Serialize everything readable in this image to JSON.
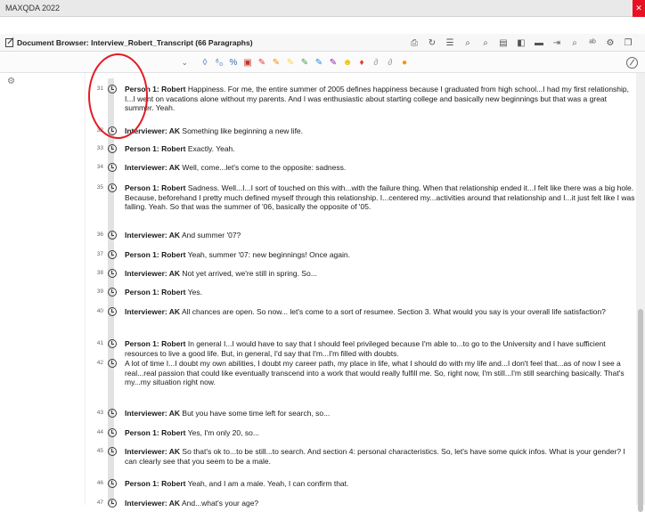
{
  "app": {
    "title": "MAXQDA 2022",
    "close": "✕"
  },
  "document": {
    "title": "Document Browser: Interview_Robert_Transcript  (66 Paragraphs)"
  },
  "header_icons": [
    "export-icon",
    "refresh-icon",
    "list-icon",
    "search-icon",
    "search-plus-icon",
    "view-icon",
    "panel-icon",
    "monitor-icon",
    "exit-icon",
    "find-icon",
    "spell-icon",
    "gear-icon",
    "window-icon"
  ],
  "toolbar": {
    "style_value": "",
    "icons": [
      {
        "name": "paragraph-icon",
        "glyph": "◊",
        "color": "#3a6fb5"
      },
      {
        "name": "format-icon",
        "glyph": "⁶₀",
        "color": "#3a6fb5"
      },
      {
        "name": "percent-icon",
        "glyph": "%",
        "color": "#3a6fb5"
      },
      {
        "name": "code-icon",
        "glyph": "▣",
        "color": "#c0392b"
      },
      {
        "name": "highlighter-red-icon",
        "glyph": "✎",
        "color": "#e53935"
      },
      {
        "name": "highlighter-orange-icon",
        "glyph": "✎",
        "color": "#fb8c00"
      },
      {
        "name": "highlighter-yellow-icon",
        "glyph": "✎",
        "color": "#fdd835"
      },
      {
        "name": "highlighter-green-icon",
        "glyph": "✎",
        "color": "#43a047"
      },
      {
        "name": "highlighter-blue-icon",
        "glyph": "✎",
        "color": "#1e88e5"
      },
      {
        "name": "highlighter-purple-icon",
        "glyph": "✎",
        "color": "#8e24aa"
      },
      {
        "name": "emoji-icon",
        "glyph": "☻",
        "color": "#f1c40f"
      },
      {
        "name": "pin-icon",
        "glyph": "♦",
        "color": "#e53935"
      },
      {
        "name": "link-icon",
        "glyph": "∂",
        "color": "#9e9e9e"
      },
      {
        "name": "link2-icon",
        "glyph": "∂",
        "color": "#9e9e9e"
      },
      {
        "name": "comment-icon",
        "glyph": "●",
        "color": "#ff8f00"
      }
    ]
  },
  "paragraphs": [
    {
      "num": "31",
      "speaker": "Person 1: Robert",
      "text": " Happiness. For me, the entire summer of 2005 defines happiness because I graduated from high school...I had my first relationship, I...I went on vacations alone without my parents. And I was enthusiastic about starting college and basically new beginnings but that was a great summer. Yeah."
    },
    {
      "num": "32",
      "speaker": "Interviewer: AK",
      "text": " Something like beginning a new life."
    },
    {
      "num": "33",
      "speaker": "Person 1: Robert",
      "text": " Exactly. Yeah."
    },
    {
      "num": "34",
      "speaker": "Interviewer: AK",
      "text": " Well, come...let's come to the opposite: sadness."
    },
    {
      "num": "35",
      "speaker": "Person 1: Robert",
      "text": " Sadness. Well...I...I sort of touched on this with...with the failure thing. When that relationship ended it...I felt like there was a big hole. Because, beforehand I pretty much defined myself through this relationship. I...centered my...activities around that relationship and I...it just felt like I was falling. Yeah. So that was the summer of '06, basically the opposite of '05."
    },
    {
      "num": "36",
      "speaker": "Interviewer: AK",
      "text": " And summer '07?"
    },
    {
      "num": "37",
      "speaker": "Person 1: Robert",
      "text": " Yeah, summer '07: new beginnings! Once again."
    },
    {
      "num": "38",
      "speaker": "Interviewer: AK",
      "text": " Not yet arrived, we're still in spring. So..."
    },
    {
      "num": "39",
      "speaker": "Person 1: Robert",
      "text": " Yes."
    },
    {
      "num": "40",
      "speaker": "Interviewer: AK",
      "text": " All chances are open. So now... let's come to a sort of resumee. Section 3. What would you say is your overall life satisfaction?"
    },
    {
      "num": "41",
      "speaker": "Person 1: Robert",
      "text": " In general I...I would have to say that I should feel privileged because I'm able to...to go to the University and I have sufficient resources to live a good life. But, in general, I'd say that I'm...I'm filled with doubts."
    },
    {
      "num": "42",
      "speaker": "",
      "text": "A lot of time I...I doubt my own abilities, I doubt my career path, my place in life, what I should do with my life and...I don't feel that...as of now I see a real...real passion that could like eventually transcend into a work that would really fulfill me. So, right now, I'm still...I'm still searching basically. That's my...my situation right now."
    },
    {
      "num": "43",
      "speaker": "Interviewer: AK",
      "text": " But you have some time left for search, so..."
    },
    {
      "num": "44",
      "speaker": "Person 1: Robert",
      "text": " Yes, I'm only 20, so..."
    },
    {
      "num": "45",
      "speaker": "Interviewer: AK",
      "text": " So that's ok to...to be still...to search. And section 4: personal characteristics. So, let's have some quick infos. What is your gender? I can clearly see that you seem to be a male."
    },
    {
      "num": "46",
      "speaker": "Person 1: Robert",
      "text": " Yeah, and I am a male. Yeah, I can confirm that."
    },
    {
      "num": "47",
      "speaker": "Interviewer: AK",
      "text": " And...what's your age?"
    }
  ]
}
